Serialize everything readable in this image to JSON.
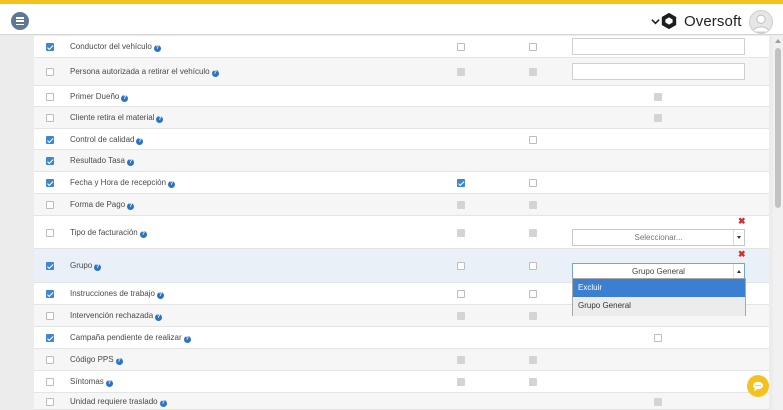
{
  "header": {
    "brand": "Oversoft",
    "menu_icon": "menu-icon",
    "avatar_icon": "user-avatar-icon",
    "colors": {
      "top_strip": "#f4c21f",
      "menu_button": "#5f7895",
      "accent": "#3f86ce",
      "remove": "#d22c2c"
    }
  },
  "help_glyph": "?",
  "rows": [
    {
      "label": "Conductor del vehículo",
      "checked": true,
      "c1": "empty",
      "c2": "empty",
      "extra": "input",
      "value": ""
    },
    {
      "label": "Persona autorizada a retirar el vehículo",
      "checked": false,
      "c1": "disabled",
      "c2": "disabled",
      "extra": "input",
      "value": ""
    },
    {
      "label": "Primer Dueño",
      "checked": false,
      "c1": "none",
      "c2": "none",
      "extra": "box-disabled"
    },
    {
      "label": "Cliente retira el material",
      "checked": false,
      "c1": "none",
      "c2": "none",
      "extra": "box-disabled"
    },
    {
      "label": "Control de calidad",
      "checked": true,
      "c1": "none",
      "c2": "empty",
      "extra": "none"
    },
    {
      "label": "Resultado Tasa",
      "checked": true,
      "c1": "none",
      "c2": "none",
      "extra": "none"
    },
    {
      "label": "Fecha y Hora de recepción",
      "checked": true,
      "c1": "checked",
      "c2": "empty",
      "extra": "none"
    },
    {
      "label": "Forma de Pago",
      "checked": false,
      "c1": "disabled",
      "c2": "disabled",
      "extra": "none"
    },
    {
      "label": "Tipo de facturación",
      "checked": false,
      "c1": "disabled",
      "c2": "disabled",
      "extra": "select",
      "value": "Seleccionar..."
    },
    {
      "label": "Grupo",
      "checked": true,
      "c1": "empty",
      "c2": "empty",
      "extra": "select-open",
      "value": "Grupo General"
    },
    {
      "label": "Instrucciones de trabajo",
      "checked": true,
      "c1": "empty",
      "c2": "empty",
      "extra": "none"
    },
    {
      "label": "Intervención rechazada",
      "checked": false,
      "c1": "disabled",
      "c2": "disabled",
      "extra": "none"
    },
    {
      "label": "Campaña pendiente de realizar",
      "checked": true,
      "c1": "none",
      "c2": "none",
      "extra": "box-empty"
    },
    {
      "label": "Código PPS",
      "checked": false,
      "c1": "disabled",
      "c2": "disabled",
      "extra": "none"
    },
    {
      "label": "Síntomas",
      "checked": false,
      "c1": "disabled",
      "c2": "disabled",
      "extra": "none"
    },
    {
      "label": "Unidad requiere traslado",
      "checked": false,
      "c1": "none",
      "c2": "none",
      "extra": "box-disabled"
    }
  ],
  "remove_glyph": "✖",
  "dropdown": {
    "options": [
      "Excluir",
      "Grupo General"
    ],
    "highlighted": "Excluir"
  },
  "chat_icon": "chat-bubble-icon"
}
